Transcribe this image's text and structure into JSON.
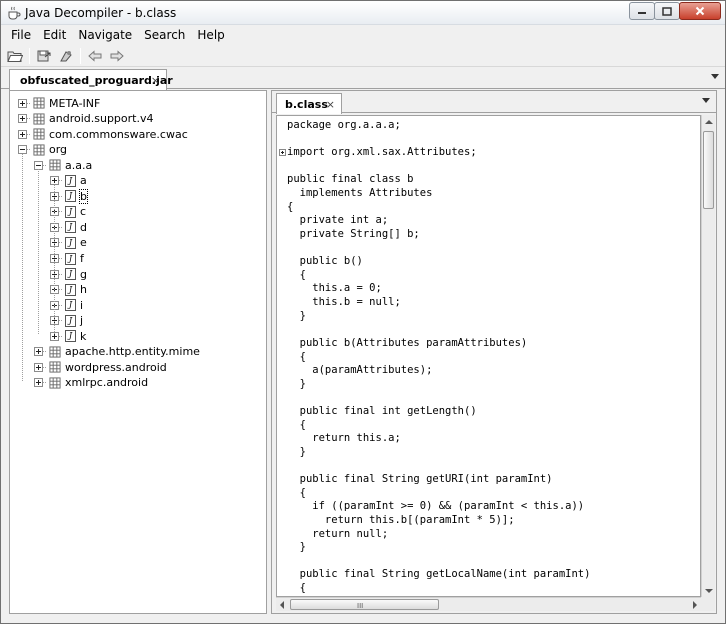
{
  "window": {
    "title": "Java Decompiler - b.class"
  },
  "menu": [
    "File",
    "Edit",
    "Navigate",
    "Search",
    "Help"
  ],
  "toolbar": {
    "icons": [
      "open-folder-icon",
      "save-icon",
      "open-type-icon",
      "back-arrow-icon",
      "forward-arrow-icon"
    ]
  },
  "outer_tab": {
    "label": "obfuscated_proguard.jar",
    "close": "×"
  },
  "tree": {
    "rows": [
      {
        "label": "META-INF",
        "type": "package",
        "expander": "plus"
      },
      {
        "label": "android.support.v4",
        "type": "package",
        "expander": "plus"
      },
      {
        "label": "com.commonsware.cwac",
        "type": "package",
        "expander": "plus"
      },
      {
        "label": "org",
        "type": "package",
        "expander": "minus"
      },
      {
        "label": "a.a.a",
        "type": "package",
        "expander": "minus"
      },
      {
        "label": "a",
        "type": "class",
        "expander": "plus"
      },
      {
        "label": "b",
        "type": "class",
        "expander": "plus",
        "selected": true
      },
      {
        "label": "c",
        "type": "class",
        "expander": "plus"
      },
      {
        "label": "d",
        "type": "class",
        "expander": "plus"
      },
      {
        "label": "e",
        "type": "class",
        "expander": "plus"
      },
      {
        "label": "f",
        "type": "class",
        "expander": "plus"
      },
      {
        "label": "g",
        "type": "class",
        "expander": "plus"
      },
      {
        "label": "h",
        "type": "class",
        "expander": "plus"
      },
      {
        "label": "i",
        "type": "class",
        "expander": "plus"
      },
      {
        "label": "j",
        "type": "class",
        "expander": "plus"
      },
      {
        "label": "k",
        "type": "class",
        "expander": "plus"
      },
      {
        "label": "apache.http.entity.mime",
        "type": "package",
        "expander": "plus"
      },
      {
        "label": "wordpress.android",
        "type": "package",
        "expander": "plus"
      },
      {
        "label": "xmlrpc.android",
        "type": "package",
        "expander": "plus"
      }
    ]
  },
  "editor": {
    "tab": {
      "label": "b.class",
      "close": "×"
    },
    "code": [
      "package org.a.a.a;",
      "",
      "import org.xml.sax.Attributes;",
      "",
      "public final class b",
      "  implements Attributes",
      "{",
      "  private int a;",
      "  private String[] b;",
      "",
      "  public b()",
      "  {",
      "    this.a = 0;",
      "    this.b = null;",
      "  }",
      "",
      "  public b(Attributes paramAttributes)",
      "  {",
      "    a(paramAttributes);",
      "  }",
      "",
      "  public final int getLength()",
      "  {",
      "    return this.a;",
      "  }",
      "",
      "  public final String getURI(int paramInt)",
      "  {",
      "    if ((paramInt >= 0) && (paramInt < this.a))",
      "      return this.b[(paramInt * 5)];",
      "    return null;",
      "  }",
      "",
      "  public final String getLocalName(int paramInt)",
      "  {"
    ],
    "hscroll_grip": "III"
  }
}
